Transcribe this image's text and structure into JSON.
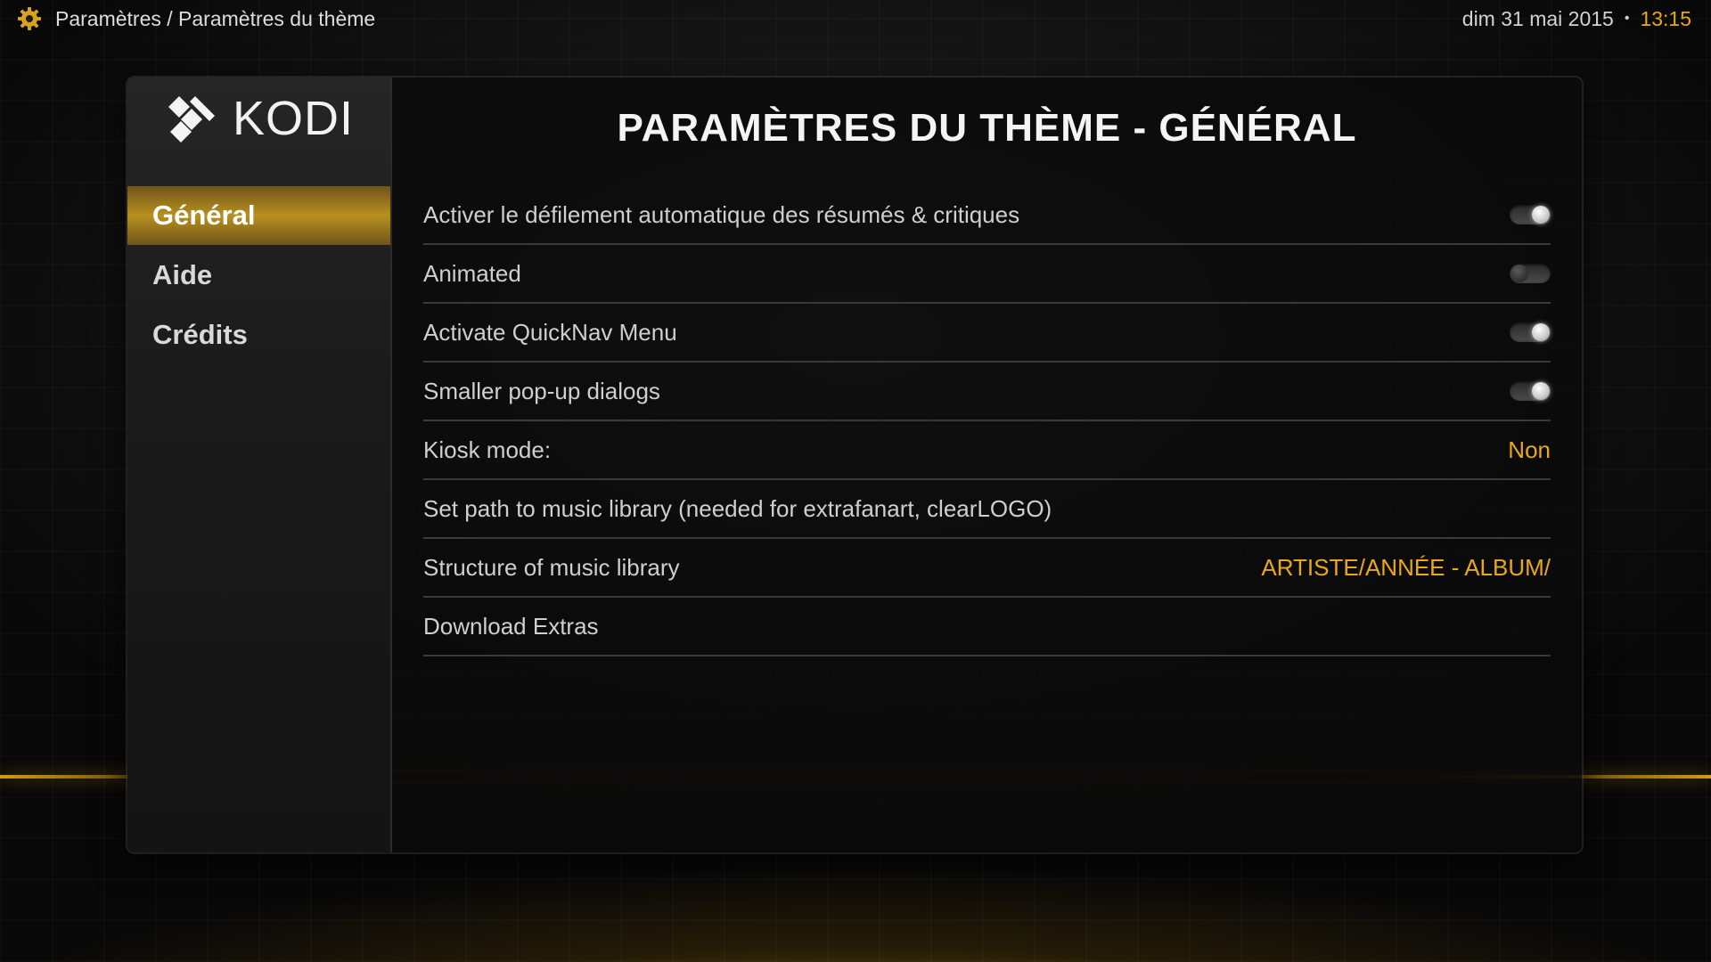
{
  "topbar": {
    "breadcrumb": "Paramètres / Paramètres du thème",
    "date": "dim 31 mai 2015",
    "separator": "•",
    "time": "13:15"
  },
  "logo": {
    "text": "KODI"
  },
  "sidebar": {
    "items": [
      {
        "label": "Général",
        "active": true
      },
      {
        "label": "Aide",
        "active": false
      },
      {
        "label": "Crédits",
        "active": false
      }
    ]
  },
  "main": {
    "title": "PARAMÈTRES DU THÈME - GÉNÉRAL",
    "settings": [
      {
        "label": "Activer le défilement automatique des résumés & critiques",
        "type": "toggle",
        "value": "on"
      },
      {
        "label": "Animated",
        "type": "toggle",
        "value": "off"
      },
      {
        "label": "Activate QuickNav Menu",
        "type": "toggle",
        "value": "on"
      },
      {
        "label": "Smaller pop-up dialogs",
        "type": "toggle",
        "value": "on"
      },
      {
        "label": "Kiosk mode:",
        "type": "text",
        "value": "Non"
      },
      {
        "label": "Set path to music library (needed for extrafanart, clearLOGO)",
        "type": "action",
        "value": ""
      },
      {
        "label": "Structure of music library",
        "type": "text",
        "value": "ARTISTE/ANNÉE - ALBUM/"
      },
      {
        "label": "Download Extras",
        "type": "action",
        "value": ""
      }
    ]
  },
  "colors": {
    "accent": "#e8a818",
    "active_nav": "#b8901f"
  },
  "icons": {
    "settings": "gear-icon",
    "logo": "kodi-logo-icon"
  }
}
